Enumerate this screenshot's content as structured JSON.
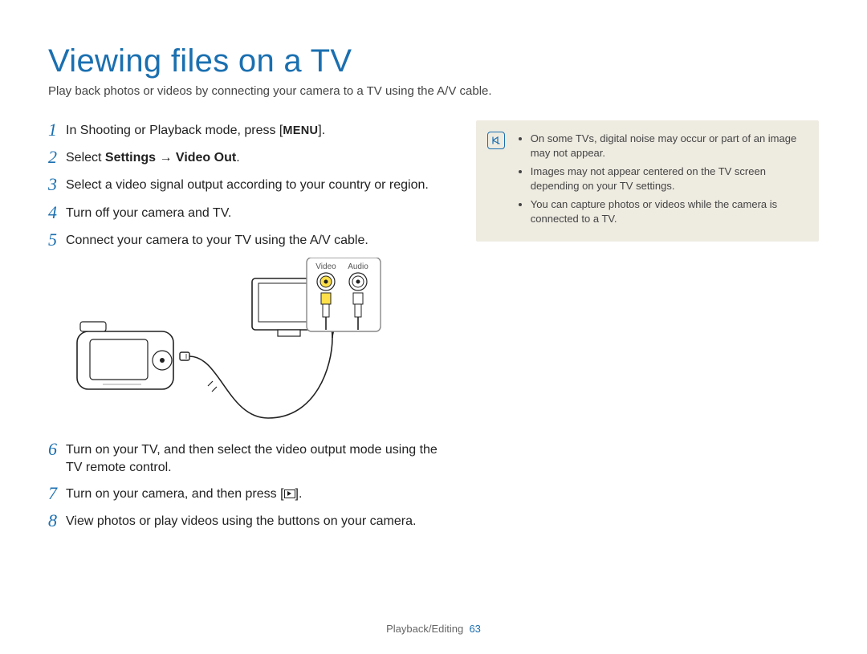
{
  "title": "Viewing files on a TV",
  "subtitle": "Play back photos or videos by connecting your camera to a TV using the A/V cable.",
  "steps": [
    {
      "num": "1",
      "pre": "In Shooting or Playback mode, press [",
      "key": "MENU",
      "post": "]."
    },
    {
      "num": "2",
      "pre": "Select ",
      "bold": "Settings → Video Out",
      "post": "."
    },
    {
      "num": "3",
      "text": "Select a video signal output according to your country or region."
    },
    {
      "num": "4",
      "text": "Turn off your camera and TV."
    },
    {
      "num": "5",
      "text": "Connect your camera to your TV using the A/V cable."
    },
    {
      "num": "6",
      "text": "Turn on your TV, and then select the video output mode using the TV remote control."
    },
    {
      "num": "7",
      "pre": "Turn on your camera, and then press [",
      "icon": "play",
      "post": "]."
    },
    {
      "num": "8",
      "text": "View photos or play videos using the buttons on your camera."
    }
  ],
  "diagram": {
    "video_label": "Video",
    "audio_label": "Audio"
  },
  "notes": [
    "On some TVs, digital noise may occur or part of an image may not appear.",
    "Images may not appear centered on the TV screen depending on your TV settings.",
    "You can capture photos or videos while the camera is connected to a TV."
  ],
  "footer": {
    "section": "Playback/Editing",
    "page": "63"
  }
}
